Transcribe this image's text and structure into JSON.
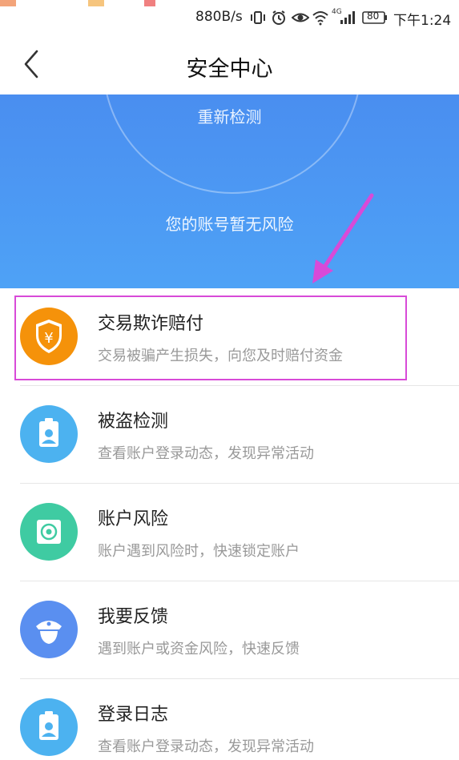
{
  "status_bar": {
    "network_speed": "880B/s",
    "signal_label": "4G",
    "battery": "80",
    "time": "下午1:24",
    "icons": [
      "vibrate-icon",
      "alarm-icon",
      "eye-icon",
      "wifi-icon",
      "signal-icon",
      "battery-icon"
    ]
  },
  "nav": {
    "title": "安全中心",
    "back_icon": "chevron-left-icon"
  },
  "hero": {
    "recheck_label": "重新检测",
    "status_text": "您的账号暂无风险",
    "colors": {
      "top": "#4a8ef0",
      "bottom": "#4ea2f6"
    }
  },
  "items": [
    {
      "title": "交易欺诈赔付",
      "subtitle": "交易被骗产生损失，向您及时赔付资金",
      "icon": "shield-yen-icon",
      "color": "#f5920a"
    },
    {
      "title": "被盗检测",
      "subtitle": "查看账户登录动态，发现异常活动",
      "icon": "badge-user-icon",
      "color": "#4cb2f0"
    },
    {
      "title": "账户风险",
      "subtitle": "账户遇到风险时，快速锁定账户",
      "icon": "lock-target-icon",
      "color": "#3fcba2"
    },
    {
      "title": "我要反馈",
      "subtitle": "遇到账户或资金风险，快速反馈",
      "icon": "officer-icon",
      "color": "#5a8ff0"
    },
    {
      "title": "登录日志",
      "subtitle": "查看账户登录动态，发现异常活动",
      "icon": "badge-user-icon",
      "color": "#4cb2f0"
    }
  ],
  "annotation": {
    "highlight_color": "#d84ad8"
  }
}
